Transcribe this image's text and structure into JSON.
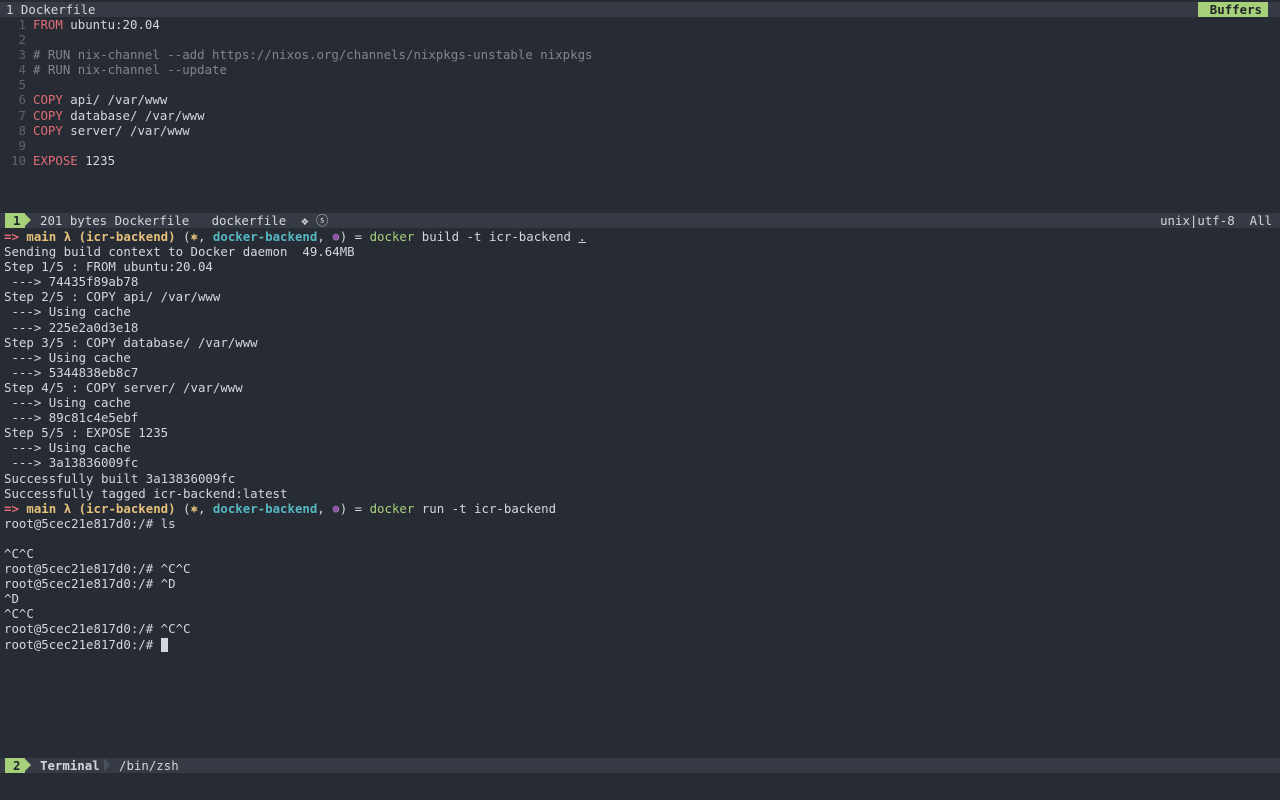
{
  "tabline": {
    "title": "1 Dockerfile",
    "buffers_label": "Buffers"
  },
  "editor": {
    "lines": [
      {
        "num": "1",
        "kw": "FROM",
        "rest": " ubuntu:20.04",
        "comment": ""
      },
      {
        "num": "2",
        "kw": "",
        "rest": "",
        "comment": ""
      },
      {
        "num": "3",
        "kw": "",
        "rest": "",
        "comment": "# RUN nix-channel --add https://nixos.org/channels/nixpkgs-unstable nixpkgs"
      },
      {
        "num": "4",
        "kw": "",
        "rest": "",
        "comment": "# RUN nix-channel --update"
      },
      {
        "num": "5",
        "kw": "",
        "rest": "",
        "comment": ""
      },
      {
        "num": "6",
        "kw": "COPY",
        "rest": " api/ /var/www",
        "comment": ""
      },
      {
        "num": "7",
        "kw": "COPY",
        "rest": " database/ /var/www",
        "comment": ""
      },
      {
        "num": "8",
        "kw": "COPY",
        "rest": " server/ /var/www",
        "comment": ""
      },
      {
        "num": "9",
        "kw": "",
        "rest": "",
        "comment": ""
      },
      {
        "num": "10",
        "kw": "EXPOSE",
        "rest": " 1235",
        "comment": ""
      }
    ]
  },
  "status1": {
    "window": "1",
    "info": "201 bytes Dockerfile   dockerfile  ❖ ⓢ",
    "right": "unix|utf-8  All"
  },
  "terminal": {
    "prompt1": {
      "arrow": "=>",
      "branch": "main λ (icr-backend)",
      "mid1": " (",
      "icon1": "⎈",
      "mid2": ", ",
      "context": "docker-backend",
      "mid3": ", ",
      "icon2": "⊛",
      "mid4": ") = ",
      "cmd": "docker",
      "args": " build -t icr-backend ",
      "dot": "."
    },
    "build_output": [
      "Sending build context to Docker daemon  49.64MB",
      "Step 1/5 : FROM ubuntu:20.04",
      " ---> 74435f89ab78",
      "Step 2/5 : COPY api/ /var/www",
      " ---> Using cache",
      " ---> 225e2a0d3e18",
      "Step 3/5 : COPY database/ /var/www",
      " ---> Using cache",
      " ---> 5344838eb8c7",
      "Step 4/5 : COPY server/ /var/www",
      " ---> Using cache",
      " ---> 89c81c4e5ebf",
      "Step 5/5 : EXPOSE 1235",
      " ---> Using cache",
      " ---> 3a13836009fc",
      "Successfully built 3a13836009fc",
      "Successfully tagged icr-backend:latest"
    ],
    "prompt2": {
      "arrow": "=>",
      "branch": "main λ (icr-backend)",
      "mid1": " (",
      "icon1": "⎈",
      "mid2": ", ",
      "context": "docker-backend",
      "mid3": ", ",
      "icon2": "⊛",
      "mid4": ") = ",
      "cmd": "docker",
      "args": " run -t icr-backend"
    },
    "run_output": [
      "root@5cec21e817d0:/# ls",
      "",
      "^C^C",
      "root@5cec21e817d0:/# ^C^C",
      "root@5cec21e817d0:/# ^D",
      "^D",
      "^C^C",
      "root@5cec21e817d0:/# ^C^C"
    ],
    "last_prompt": "root@5cec21e817d0:/# "
  },
  "status2": {
    "window": "2",
    "tab": "Terminal",
    "shell": "/bin/zsh"
  }
}
